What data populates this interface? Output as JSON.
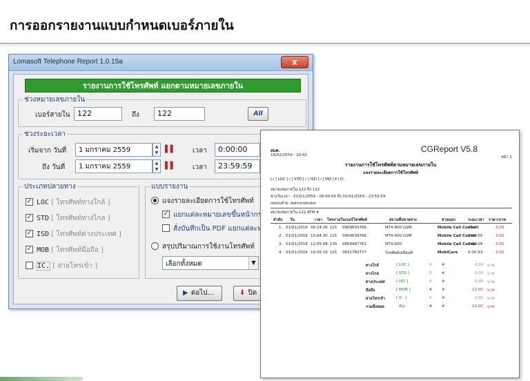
{
  "slide": {
    "title": "การออกรายงานแบบกำหนดเบอร์ภายใน"
  },
  "window": {
    "title": "Lomasoft Telephone Report 1.0.15a",
    "close_label": "x",
    "banner": "รายงานการใช้โทรศัพท์ แยกตามหมายเลขภายใน"
  },
  "ext_range": {
    "label": "ช่วงหมายเลขภายใน",
    "from_label": "เบอร์สายใน",
    "from_value": "122",
    "to_label": "ถึง",
    "to_value": "122",
    "all_button": "All"
  },
  "period": {
    "label": "ช่วงระยะเวลา",
    "start_label": "เริ่มจาก วันที่",
    "start_date": "1  มกราคม   2559",
    "end_label": "ถึง วันที่",
    "end_date": "1  มกราคม   2559",
    "time_label": "เวลา",
    "start_time": "0:00:00",
    "end_time": "23:59:59"
  },
  "call_types": {
    "label": "ประเภทปลายทาง",
    "items": [
      {
        "checked": true,
        "code": "LOC",
        "desc": "[ โทรศัพท์ทางใกล้ ]"
      },
      {
        "checked": true,
        "code": "STD",
        "desc": "[ โทรศัพท์ทางไกล ]"
      },
      {
        "checked": true,
        "code": "ISD",
        "desc": "[ โทรศัพท์ต่างประเทศ ]"
      },
      {
        "checked": true,
        "code": "MOB",
        "desc": "[ โทรศัพท์มือถือ ]"
      },
      {
        "checked": false,
        "code": "IC.",
        "desc": "[ สายโทรเข้า ]"
      }
    ]
  },
  "report_mode": {
    "label": "แบบรายงาน",
    "option1": "แจงรายละเอียดการใช้โทรศัพท์",
    "sub1": "แยกแต่ละหมายเลขขึ้นหน้ากระด",
    "sub2": "สั่งบันทึกเป็น PDF แยกแต่ละหม",
    "option2": "สรุปปริมาณการใช้งานโทรศัพท์",
    "select_value": "เลือกทั้งหมด"
  },
  "buttons": {
    "next": "ต่อไป...",
    "close": "ปิด"
  },
  "report": {
    "company": "สมศ.",
    "printed": "16/02/2559 - 20:42",
    "app_title": "CGReport V5.8",
    "page": "หน้า 1",
    "heading1": "รายงานการใช้โทรศัพท์ตามหมายเลขภายใน",
    "heading2": "แจงรายละเอียดการใช้โทรศัพท์",
    "filters": "[✓] LOC  [✓] STD  [✓] ISD  [✓] MO  [✗] IC.",
    "ext_line": "หมายเลขภายใน    122    ถึง    122",
    "period_line": "ช่วงวันเวลา :  01/01/2559 - 00:00:00     ถึง  01/01/2559 - 23:59:59",
    "dept_line": "แผนก/ฝ่าย:      Administrator",
    "group_line": "หมายเลขภายใน    122        ATM 4",
    "columns": [
      "ลำดับ",
      "วัน",
      "เวลา",
      "โทรภายใน",
      "เบอร์โทรศัพท์",
      "สถานที่ปลายทาง",
      "สายนอก",
      "ระยะเวลา",
      "ราคา/บาท"
    ],
    "rows": [
      [
        "1.",
        "01/01/2016",
        "09:24:26",
        "121",
        "0909639766",
        "MTX-900 GSM",
        "Mobile Call Center",
        "00:08",
        "3.00"
      ],
      [
        "2.",
        "01/01/2016",
        "10:04:30",
        "121",
        "0909639766",
        "MTX-900 GSM",
        "Mobile Call Center",
        "0:00:56",
        "3.00"
      ],
      [
        "3.",
        "01/01/2016",
        "12:05:48",
        "135",
        "0859987761",
        "MTX-900",
        "Mobile Call Center",
        "0:00:28",
        "3.00"
      ],
      [
        "4.",
        "01/01/2016",
        "16:05:16",
        "121",
        "0831782777",
        "โทรศัพท์เคลื่อนที่",
        "MobiCare",
        "0:00:33",
        "3.00"
      ]
    ],
    "summary": [
      {
        "label": "ทางใกล้",
        "code": "[ LOC ]",
        "count": "0",
        "amount": "0.00",
        "unit": "บาท",
        "hl": false
      },
      {
        "label": "ทางไกล",
        "code": "[ STD ]",
        "count": "0",
        "amount": "0.00",
        "unit": "บาท",
        "hl": false
      },
      {
        "label": "ต่างประเทศ",
        "code": "[ ISD ]",
        "count": "0",
        "amount": "0.00",
        "unit": "บาท",
        "hl": false
      },
      {
        "label": "มือถือ",
        "code": "[ MOB ]",
        "count": "4",
        "amount": "12.00",
        "unit": "บาท",
        "hl": true
      },
      {
        "label": "สายโทรเข้า",
        "code": "[ IC. ]",
        "count": "0",
        "amount": "0.00",
        "unit": "บาท",
        "hl": false
      },
      {
        "label": "รวมทั้งหมด",
        "code": "ALL",
        "count": "4",
        "amount": "12.00",
        "unit": "บาท",
        "hl": true
      }
    ]
  }
}
